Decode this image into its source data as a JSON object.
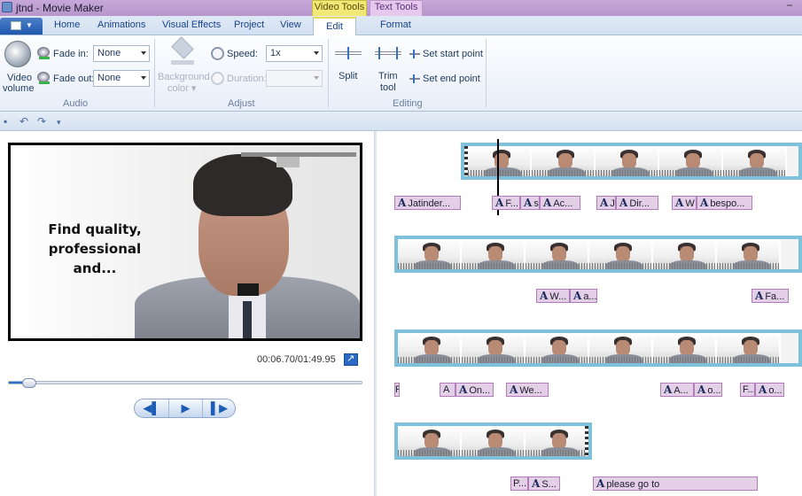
{
  "window": {
    "title": "jtnd - Movie Maker",
    "minimize_glyph": "−"
  },
  "context_tabs": {
    "video_tools": "Video Tools",
    "text_tools": "Text Tools"
  },
  "tabs": [
    {
      "label": "Home"
    },
    {
      "label": "Animations"
    },
    {
      "label": "Visual Effects"
    },
    {
      "label": "Project"
    },
    {
      "label": "View"
    },
    {
      "label": "Edit"
    },
    {
      "label": "Format"
    }
  ],
  "ribbon": {
    "audio": {
      "group_label": "Audio",
      "video_volume_label_1": "Video",
      "video_volume_label_2": "volume",
      "fade_in_label": "Fade in:",
      "fade_in_value": "None",
      "fade_out_label": "Fade out:",
      "fade_out_value": "None"
    },
    "adjust": {
      "group_label": "Adjust",
      "background_label_1": "Background",
      "background_label_2": "color ▾",
      "speed_label": "Speed:",
      "speed_value": "1x",
      "duration_label": "Duration:",
      "duration_value": ""
    },
    "editing": {
      "group_label": "Editing",
      "split_label": "Split",
      "trim_label_1": "Trim",
      "trim_label_2": "tool",
      "set_start_label": "Set start point",
      "set_end_label": "Set end point"
    }
  },
  "qat": {
    "save_glyph": "▪",
    "undo_glyph": "↶",
    "redo_glyph": "↷",
    "more_glyph": "▾"
  },
  "preview": {
    "caption_line1": "Find quality,",
    "caption_line2": "professional and...",
    "timecode": "00:06.70/01:49.95",
    "seek_position": 0.061,
    "prev_glyph": "◀▌",
    "play_glyph": "▶",
    "next_glyph": "▌▶"
  },
  "storyboard": {
    "row1_captions": [
      {
        "text": "Jatinder..."
      },
      {
        "text": "F..."
      },
      {
        "text": "s"
      },
      {
        "text": "Ac..."
      },
      {
        "text": "J"
      },
      {
        "text": "Dir..."
      },
      {
        "text": "W"
      },
      {
        "text": "bespo..."
      }
    ],
    "row2_captions": [
      {
        "text": "W..."
      },
      {
        "text": "a..."
      },
      {
        "text": "Fa..."
      }
    ],
    "row3_captions": [
      {
        "text": "F"
      },
      {
        "text": "A"
      },
      {
        "text": "On..."
      },
      {
        "text": "We..."
      },
      {
        "text": "A..."
      },
      {
        "text": "o..."
      },
      {
        "text": "F..."
      },
      {
        "text": "o..."
      }
    ],
    "row4_captions": [
      {
        "text": "P..."
      },
      {
        "text": "S..."
      },
      {
        "text": "please go to"
      }
    ]
  }
}
